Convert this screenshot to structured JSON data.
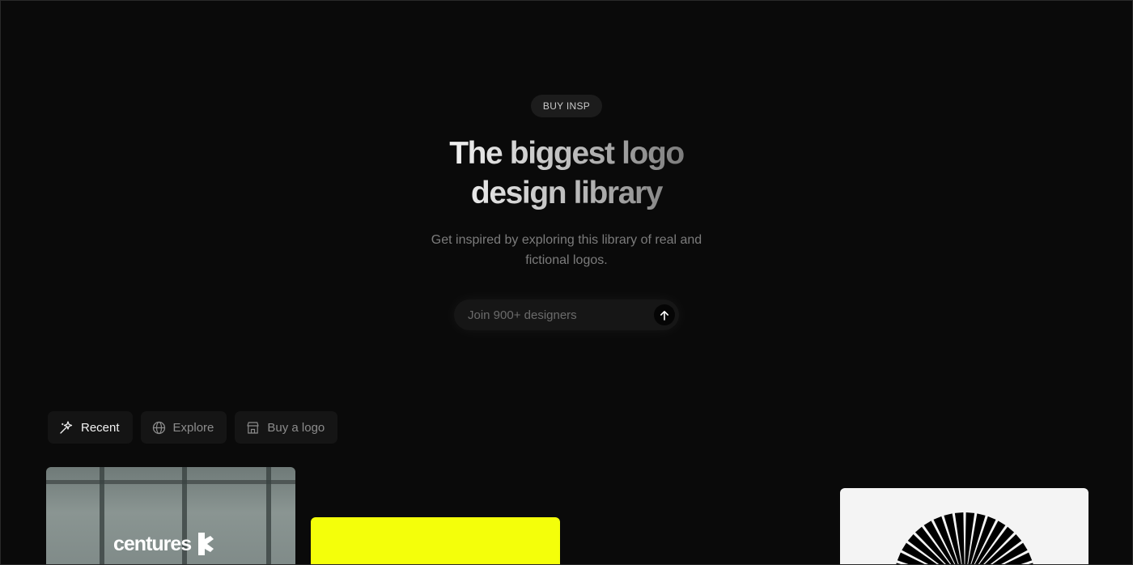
{
  "hero": {
    "badge": "BUY INSP",
    "headline_line1": "The biggest logo",
    "headline_line2": "design library",
    "subtext": "Get inspired by exploring this library of real and fictional logos.",
    "signup_placeholder": "Join 900+ designers",
    "submit_icon": "arrow-up-icon"
  },
  "tabs": [
    {
      "label": "Recent",
      "icon": "sparkle-icon",
      "active": true
    },
    {
      "label": "Explore",
      "icon": "globe-icon",
      "active": false
    },
    {
      "label": "Buy a logo",
      "icon": "store-icon",
      "active": false
    }
  ],
  "cards": [
    {
      "logo_text": "centures",
      "background": "#7d8886"
    },
    {
      "background": "#f4ff0a"
    },
    {
      "background": "#f4f4f4",
      "logo": "sunburst-logo"
    }
  ],
  "colors": {
    "background": "#0a0a0a",
    "accent_yellow": "#f4ff0a"
  }
}
